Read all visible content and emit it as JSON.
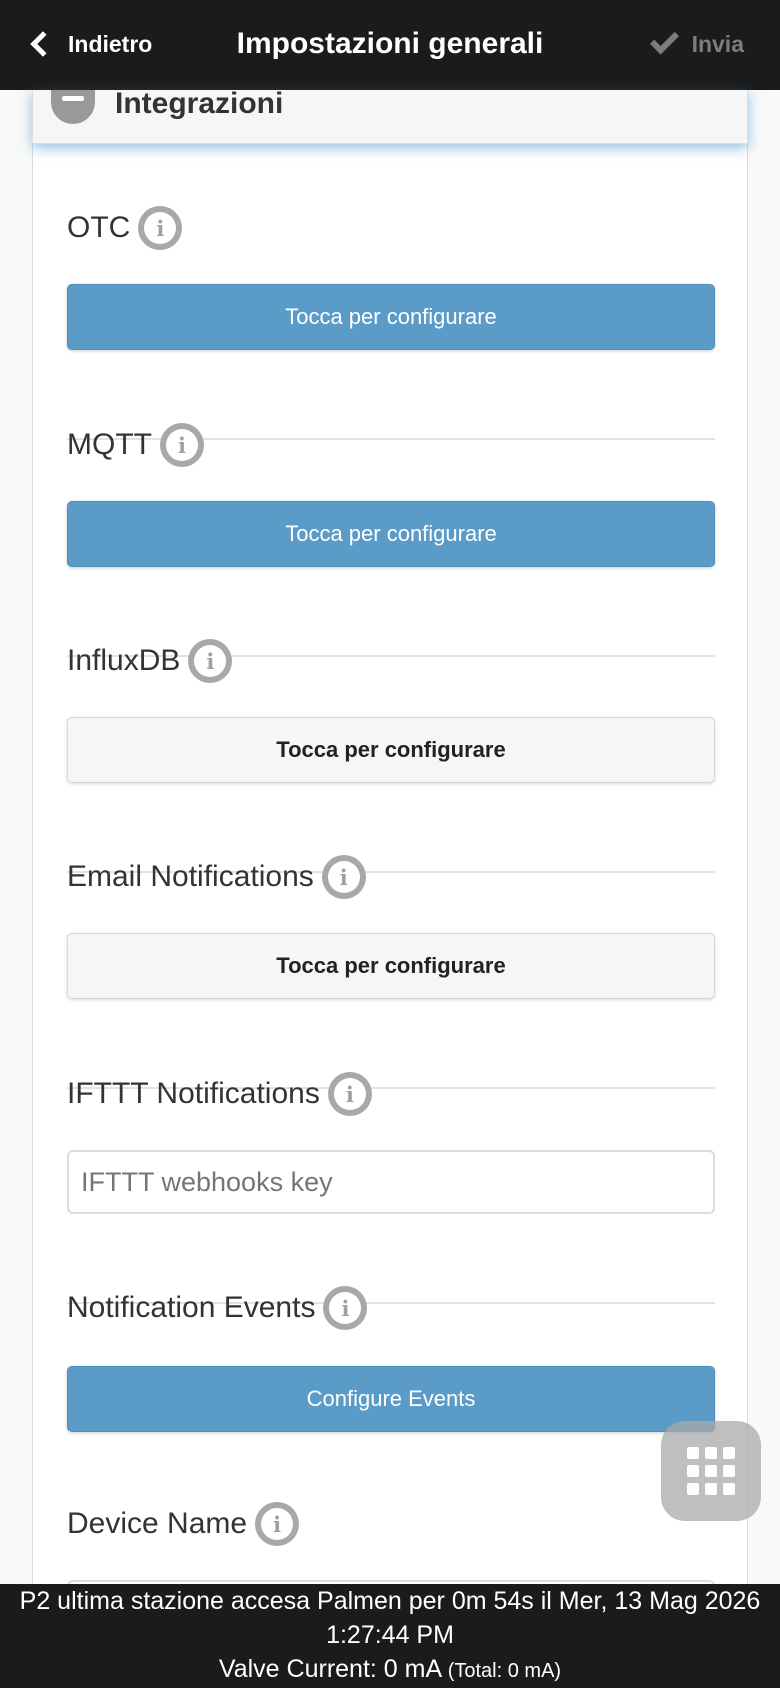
{
  "header": {
    "back_label": "Indietro",
    "title": "Impostazioni generali",
    "send_label": "Invia"
  },
  "section": {
    "title": "Integrazioni"
  },
  "items": [
    {
      "label": "OTC",
      "control": "button",
      "style": "primary",
      "text": "Tocca per configurare"
    },
    {
      "label": "MQTT",
      "control": "button",
      "style": "primary",
      "text": "Tocca per configurare"
    },
    {
      "label": "InfluxDB",
      "control": "button",
      "style": "default",
      "text": "Tocca per configurare"
    },
    {
      "label": "Email Notifications",
      "control": "button",
      "style": "default",
      "text": "Tocca per configurare"
    },
    {
      "label": "IFTTT Notifications",
      "control": "input",
      "placeholder": "IFTTT webhooks key"
    },
    {
      "label": "Notification Events",
      "control": "button",
      "style": "primary",
      "text": "Configure Events"
    },
    {
      "label": "Device Name",
      "control": "input",
      "placeholder": ""
    }
  ],
  "info_glyph": "i",
  "footer": {
    "status": "P2 ultima stazione accesa Palmen per 0m 54s il Mer, 13 Mag 2026 1:27:44 PM",
    "valve_current": "Valve Current: 0 mA",
    "total": "(Total: 0 mA)"
  },
  "colors": {
    "header_bg": "#1b1b1b",
    "primary_button": "#5a9bc8",
    "section_glow": "#388ecc"
  },
  "icons": {
    "back": "chevron-left-icon",
    "send": "check-icon",
    "section": "minus-circle-icon",
    "info": "info-icon",
    "fab": "grid-icon"
  }
}
